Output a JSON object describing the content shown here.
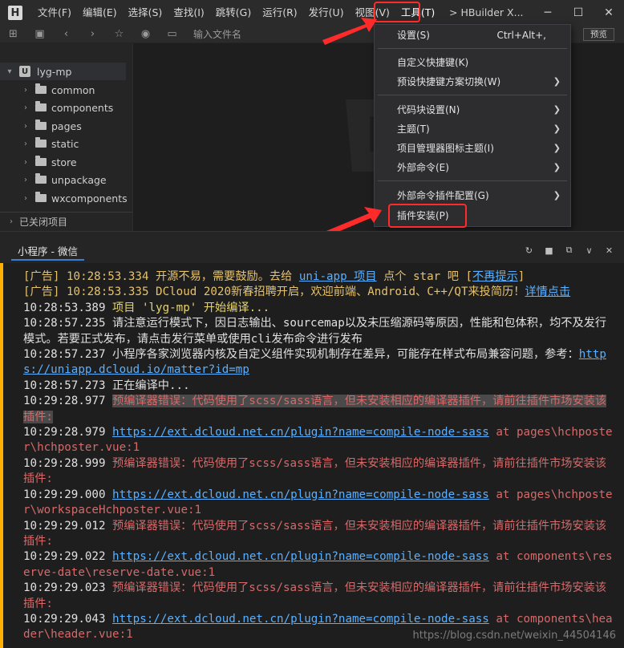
{
  "menubar": {
    "items": [
      "文件(F)",
      "编辑(E)",
      "选择(S)",
      "查找(I)",
      "跳转(G)",
      "运行(R)",
      "发行(U)",
      "视图(V)",
      "工具(T)"
    ],
    "window_title": "HBuilder X...",
    "icons": [
      "minimize-icon",
      "maximize-icon",
      "close-icon"
    ]
  },
  "toolbar": {
    "search_placeholder": "输入文件名",
    "preview_label": "预览"
  },
  "sidebar": {
    "project": "lyg-mp",
    "folders": [
      "common",
      "components",
      "pages",
      "static",
      "store",
      "unpackage",
      "wxcomponents"
    ],
    "closed_projects": "已关闭项目"
  },
  "tools_menu": {
    "items": [
      {
        "label": "设置(S)",
        "shortcut": "Ctrl+Alt+,",
        "submenu": false
      },
      {
        "label": "自定义快捷键(K)",
        "shortcut": "",
        "submenu": false
      },
      {
        "label": "预设快捷键方案切换(W)",
        "shortcut": "",
        "submenu": true
      },
      {
        "label": "代码块设置(N)",
        "shortcut": "",
        "submenu": true
      },
      {
        "label": "主题(T)",
        "shortcut": "",
        "submenu": true
      },
      {
        "label": "项目管理器图标主题(I)",
        "shortcut": "",
        "submenu": true
      },
      {
        "label": "外部命令(E)",
        "shortcut": "",
        "submenu": true
      },
      {
        "label": "外部命令插件配置(G)",
        "shortcut": "",
        "submenu": true
      },
      {
        "label": "插件安装(P)",
        "shortcut": "",
        "submenu": false
      }
    ]
  },
  "console": {
    "tab": "小程序 - 微信",
    "lines": {
      "l1_ts": "[广告] 10:28:53.334 ",
      "l1_text": "开源不易，需要鼓励。去给 ",
      "l1_link": "uni-app 项目",
      "l1_text2": " 点个 star 吧 [",
      "l1_link2": "不再提示",
      "l1_end": "]",
      "l2_ts": "[广告] 10:28:53.335 ",
      "l2_text": "DCloud 2020新春招聘开启，欢迎前端、Android、C++/QT来投简历！",
      "l2_link": "详情点击",
      "l3_ts": "10:28:53.389 ",
      "l3_text": "项目 'lyg-mp' 开始编译...",
      "l4_ts": "10:28:57.235 ",
      "l4_text": "请注意运行模式下，因日志输出、sourcemap以及未压缩源码等原因，性能和包体积，均不及发行模式。若要正式发布，请点击发行菜单或使用cli发布命令进行发布",
      "l5_ts": "10:28:57.237 ",
      "l5_text": "小程序各家浏览器内核及自定义组件实现机制存在差异，可能存在样式布局兼容问题，参考：",
      "l5_link": "https://uniapp.dcloud.io/matter?id=mp",
      "l6_ts": "10:28:57.273 ",
      "l6_text": "正在编译中...",
      "e1_ts": "10:29:28.977 ",
      "e1_text": "预编译器错误：代码使用了scss/sass语言，但未安装相应的编译器插件，请前往插件市场安装该插件:",
      "p1_ts": "10:29:28.979 ",
      "p1_link": "https://ext.dcloud.net.cn/plugin?name=compile-node-sass",
      "p1_text": " at pages\\hchposter\\hchposter.vue:1",
      "e2_ts": "10:29:28.999 ",
      "e2_text": "预编译器错误：代码使用了scss/sass语言，但未安装相应的编译器插件，请前往插件市场安装该插件:",
      "p2_ts": "10:29:29.000 ",
      "p2_link": "https://ext.dcloud.net.cn/plugin?name=compile-node-sass",
      "p2_text": " at pages\\hchposter\\workspaceHchposter.vue:1",
      "e3_ts": "10:29:29.012 ",
      "e3_text": "预编译器错误：代码使用了scss/sass语言，但未安装相应的编译器插件，请前往插件市场安装该插件:",
      "p3_ts": "10:29:29.022 ",
      "p3_link": "https://ext.dcloud.net.cn/plugin?name=compile-node-sass",
      "p3_text": " at components\\reserve-date\\reserve-date.vue:1",
      "e4_ts": "10:29:29.023 ",
      "e4_text": "预编译器错误：代码使用了scss/sass语言，但未安装相应的编译器插件，请前往插件市场安装该插件:",
      "p4_ts": "10:29:29.043 ",
      "p4_link": "https://ext.dcloud.net.cn/plugin?name=compile-node-sass",
      "p4_text": " at components\\header\\header.vue:1"
    }
  },
  "watermark": "https://blog.csdn.net/weixin_44504146",
  "colors": {
    "highlight_red": "#ff2b2b",
    "link": "#5ab0ff",
    "error": "#d46a6a",
    "ad": "#e6c26c"
  }
}
